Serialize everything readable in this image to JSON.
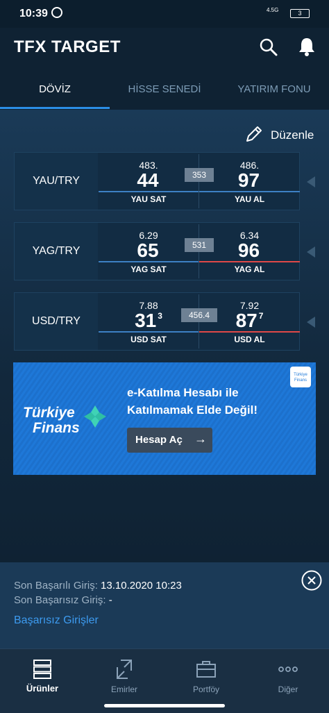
{
  "status_bar": {
    "time": "10:39",
    "network": "4.5G",
    "battery": "3"
  },
  "app": {
    "title": "TFX TARGET"
  },
  "tabs": [
    {
      "label": "DÖVİZ",
      "active": true
    },
    {
      "label": "HİSSE SENEDİ",
      "active": false
    },
    {
      "label": "YATIRIM FONU",
      "active": false
    }
  ],
  "edit_label": "Düzenle",
  "fx_rows": [
    {
      "pair": "YAU/TRY",
      "sell_top": "483.",
      "sell_big": "44",
      "sell_sup": "",
      "spread": "353",
      "buy_top": "486.",
      "buy_big": "97",
      "buy_sup": "",
      "sell_label": "YAU SAT",
      "buy_label": "YAU AL"
    },
    {
      "pair": "YAG/TRY",
      "sell_top": "6.29",
      "sell_big": "65",
      "sell_sup": "",
      "spread": "531",
      "buy_top": "6.34",
      "buy_big": "96",
      "buy_sup": "",
      "sell_label": "YAG SAT",
      "buy_label": "YAG AL"
    },
    {
      "pair": "USD/TRY",
      "sell_top": "7.88",
      "sell_big": "31",
      "sell_sup": "3",
      "spread": "456.4",
      "buy_top": "7.92",
      "buy_big": "87",
      "buy_sup": "7",
      "sell_label": "USD SAT",
      "buy_label": "USD AL"
    }
  ],
  "banner": {
    "brand_line1": "Türkiye",
    "brand_line2": "Finans",
    "headline_line1": "e-Katılma Hesabı ile",
    "headline_line2": "Katılmamak Elde Değil!",
    "cta": "Hesap Aç",
    "cta_arrow": "→",
    "mini_logo": "Türkiye Finans"
  },
  "login": {
    "last_success_label": "Son Başarılı Giriş:",
    "last_success_value": "13.10.2020 10:23",
    "last_fail_label": "Son Başarısız Giriş:",
    "last_fail_value": "-",
    "failed_logins_link": "Başarısız Girişler"
  },
  "bottom_nav": [
    {
      "label": "Ürünler",
      "active": true
    },
    {
      "label": "Emirler",
      "active": false
    },
    {
      "label": "Portföy",
      "active": false
    },
    {
      "label": "Diğer",
      "active": false
    }
  ],
  "colors": {
    "accent": "#2b8ee6",
    "sell_line": "#3d80c4",
    "buy_line": "#e04848",
    "banner_bg": "#1e78d8"
  }
}
